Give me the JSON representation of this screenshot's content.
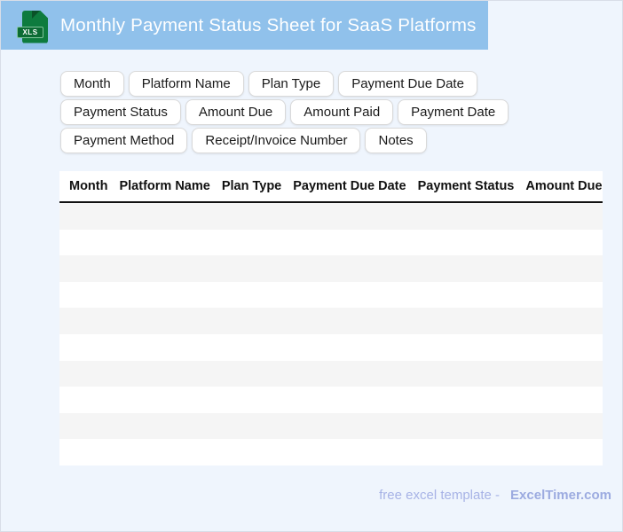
{
  "header": {
    "title": "Monthly Payment Status Sheet for SaaS Platforms",
    "file_icon_label": "XLS"
  },
  "field_chips": [
    "Month",
    "Platform Name",
    "Plan Type",
    "Payment Due Date",
    "Payment Status",
    "Amount Due",
    "Amount Paid",
    "Payment Date",
    "Payment Method",
    "Receipt/Invoice Number",
    "Notes"
  ],
  "table": {
    "columns": [
      "Month",
      "Platform Name",
      "Plan Type",
      "Payment Due Date",
      "Payment Status",
      "Amount Due"
    ],
    "empty_row_count": 10,
    "rows": []
  },
  "footer": {
    "prefix": "free excel template -",
    "brand": "ExcelTimer.com"
  },
  "colors": {
    "header_bg": "#90C1EB",
    "page_bg": "#EFF5FD",
    "row_stripe": "#F5F5F5",
    "icon_green": "#0E7B3E",
    "icon_green_dark": "#0A5128",
    "footer_text": "#A7B3E6",
    "footer_brand": "#9CABE0",
    "table_header_text": "#111111",
    "chip_text": "#1A1A1A"
  }
}
